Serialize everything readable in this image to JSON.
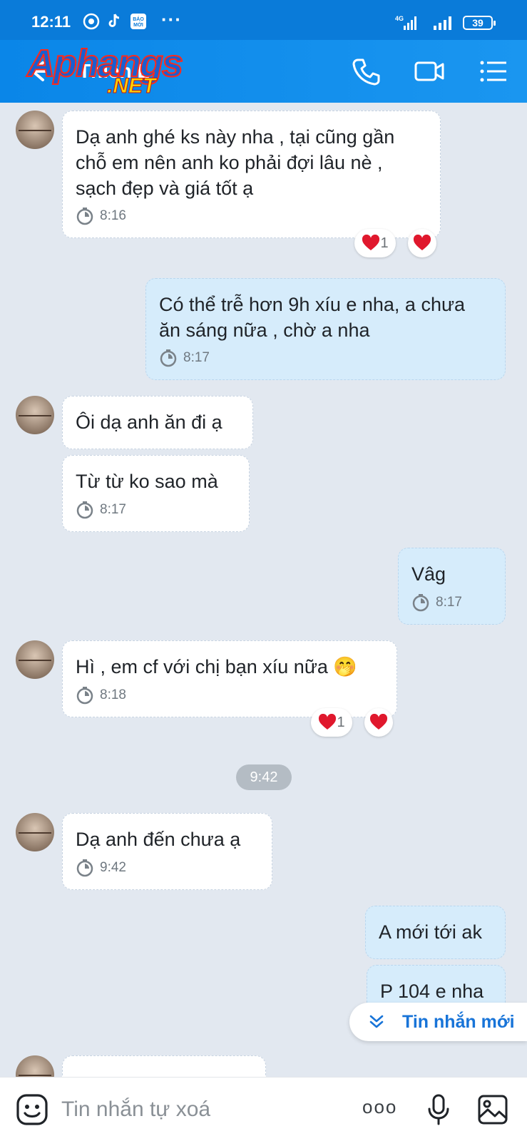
{
  "status_bar": {
    "time": "12:11",
    "news_badge": "BÁO MỚI",
    "network": "4G",
    "battery": "39"
  },
  "header": {
    "contact_name": "Thiên L",
    "watermark": {
      "brand": "Aphangs",
      "suffix": ".NET"
    }
  },
  "messages": [
    {
      "sender": "contact",
      "text": "Dạ anh ghé ks này nha , tại cũng gần\nchỗ em nên anh ko phải đợi lâu nè ,\nsạch đẹp và giá tốt ạ",
      "time": "8:16",
      "reaction_count": "1"
    },
    {
      "sender": "me",
      "text": "Có thể trễ hơn 9h xíu e nha, a chưa\năn sáng nữa , chờ a nha",
      "time": "8:17"
    },
    {
      "sender": "contact",
      "text": "Ôi dạ anh ăn đi ạ"
    },
    {
      "sender": "contact",
      "text": "Từ từ ko sao mà",
      "time": "8:17"
    },
    {
      "sender": "me",
      "text": "Vâg",
      "time": "8:17"
    },
    {
      "sender": "contact",
      "text": "Hì , em cf với chị bạn xíu nữa 🤭",
      "time": "8:18",
      "reaction_count": "1"
    },
    {
      "sender": "contact",
      "text": "Dạ anh đến chưa ạ",
      "time": "9:42"
    },
    {
      "sender": "me",
      "text": "A mới tới ak"
    },
    {
      "sender": "me",
      "text": "P 104 e nha"
    }
  ],
  "time_divider": "9:42",
  "new_messages_button": "Tin nhắn mới",
  "input": {
    "placeholder": "Tin nhắn tự xoá",
    "more_icon": "ooo"
  },
  "colors": {
    "header": "#0a86e8",
    "outgoing_bubble": "#d6ecfb",
    "incoming_bubble": "#ffffff",
    "background": "#e2e8f0",
    "heart": "#e0182d"
  }
}
